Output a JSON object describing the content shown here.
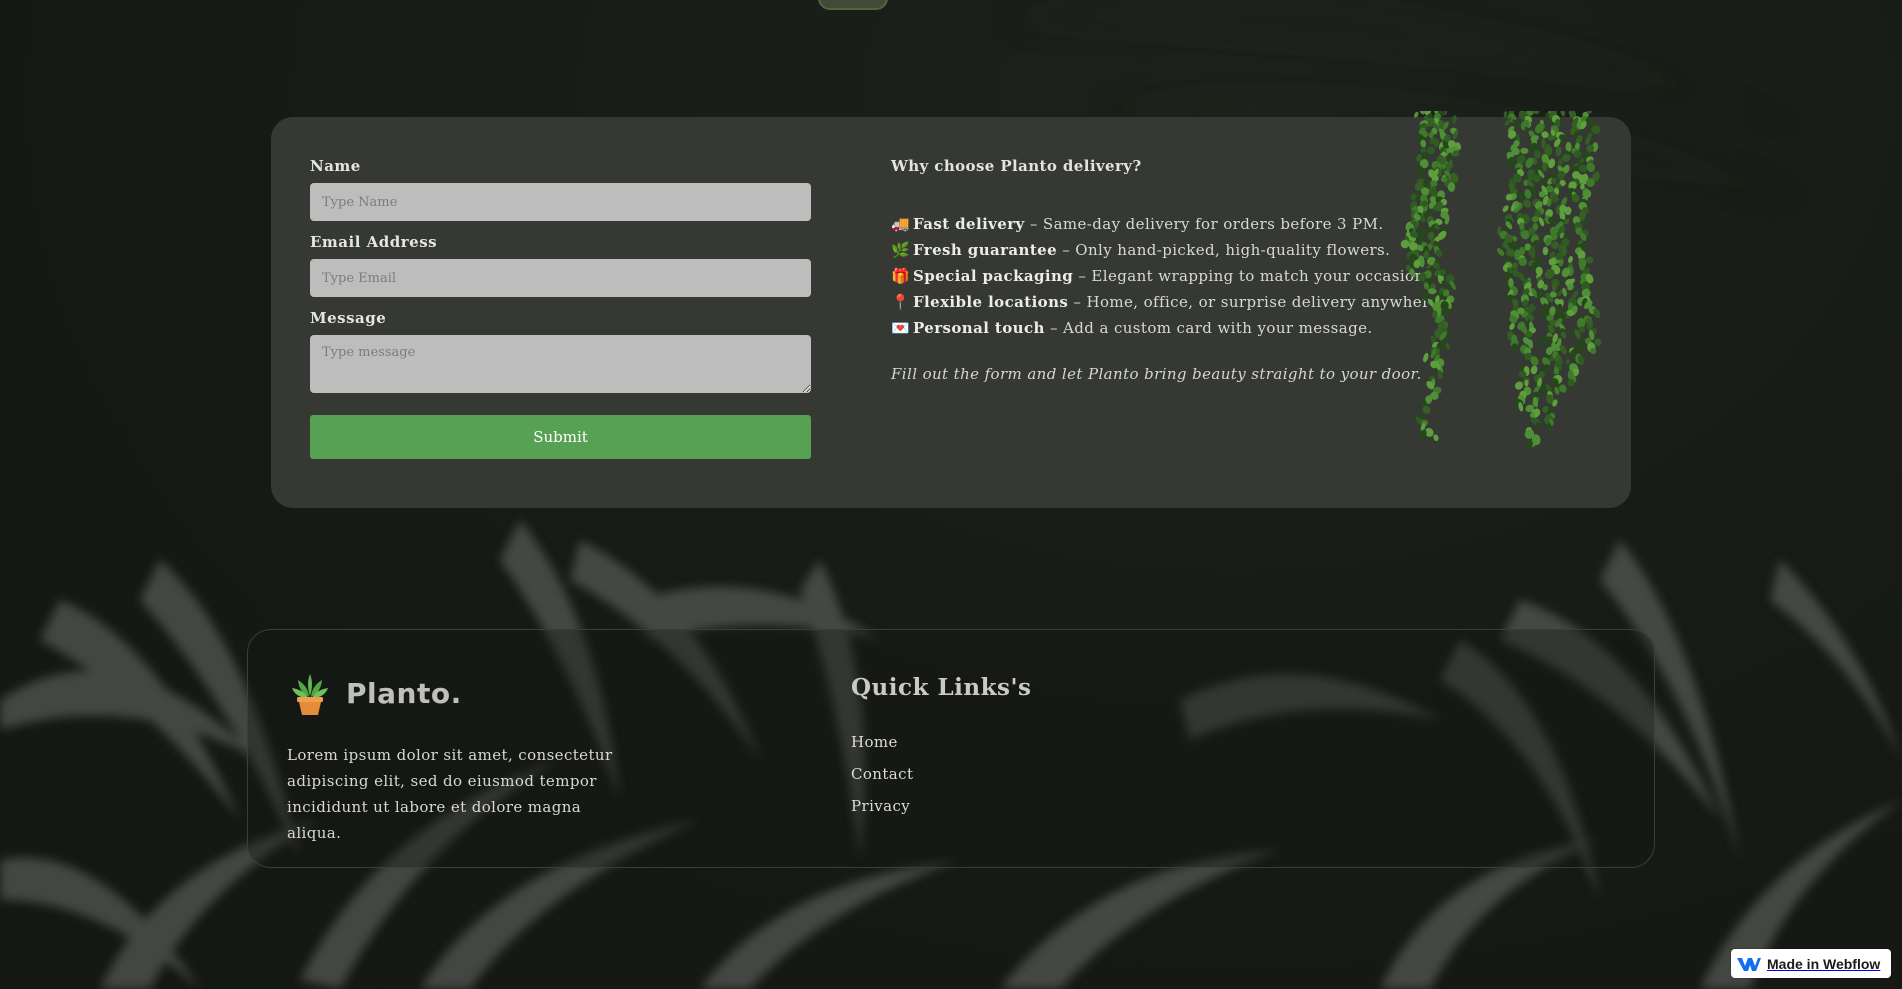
{
  "form": {
    "name_label": "Name",
    "name_placeholder": "Type Name",
    "email_label": "Email Address",
    "email_placeholder": "Type Email",
    "message_label": "Message",
    "message_placeholder": "Type message",
    "submit_label": "Submit"
  },
  "why": {
    "title": "Why choose Planto delivery?",
    "items": [
      {
        "icon": "🚚",
        "icon_name": "delivery-truck-icon",
        "title": "Fast delivery",
        "text": " – Same-day delivery for orders before 3 PM."
      },
      {
        "icon": "🌿",
        "icon_name": "herb-icon",
        "title": "Fresh guarantee",
        "text": " – Only hand-picked, high-quality flowers."
      },
      {
        "icon": "🎁",
        "icon_name": "gift-icon",
        "title": "Special packaging",
        "text": " – Elegant wrapping to match your occasion."
      },
      {
        "icon": "📍",
        "icon_name": "location-pin-icon",
        "title": "Flexible locations",
        "text": " – Home, office, or surprise delivery anywhere."
      },
      {
        "icon": "💌",
        "icon_name": "love-letter-icon",
        "title": "Personal touch",
        "text": " – Add a custom card with your message."
      }
    ],
    "cta": "Fill out the form and let Planto bring beauty straight to your door."
  },
  "footer": {
    "brand_name": "Planto.",
    "description": "Lorem ipsum dolor sit amet, consectetur adipiscing elit, sed do eiusmod tempor incididunt ut labore et dolore magna aliqua.",
    "quick_links_title": "Quick Links's",
    "links": [
      "Home",
      "Contact",
      "Privacy"
    ]
  },
  "badge": {
    "label": "Made in Webflow"
  },
  "colors": {
    "background": "#171a15",
    "card": "#353833",
    "input": "#bdbdbd",
    "submit": "#57a154",
    "accent_green": "#4f8a3a"
  }
}
